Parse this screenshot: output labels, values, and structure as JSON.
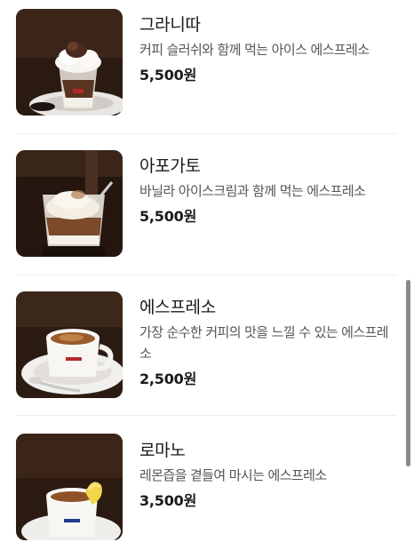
{
  "menu": {
    "items": [
      {
        "name": "그라니따",
        "description": "커피 슬러쉬와 함께 먹는 아이스 에스프레소",
        "price": "5,500원",
        "image": "granita-photo"
      },
      {
        "name": "아포가토",
        "description": "바닐라 아이스크림과 함께 먹는 에스프레소",
        "price": "5,500원",
        "image": "affogato-photo"
      },
      {
        "name": "에스프레소",
        "description": "가장 순수한 커피의 맛을 느낄 수 있는 에스프레소",
        "price": "2,500원",
        "image": "espresso-photo"
      },
      {
        "name": "로마노",
        "description": "레몬즙을 곁들여 마시는 에스프레소",
        "price": "3,500원",
        "image": "romano-photo"
      }
    ]
  },
  "colors": {
    "background": "#ffffff",
    "text_primary": "#1a1a1a",
    "text_secondary": "#555555",
    "divider": "#eeeeee",
    "scrollbar": "#8a8a8a"
  }
}
